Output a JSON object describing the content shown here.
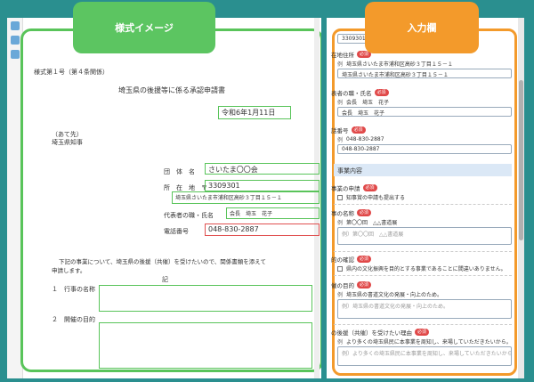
{
  "headers": {
    "left": "様式イメージ",
    "right": "入力欄"
  },
  "colors": {
    "background": "#2a8f8f",
    "green": "#5cc561",
    "orange": "#f39a2b",
    "required": "#e04848"
  },
  "document": {
    "form_no": "様式第１号（第４条関係）",
    "title": "埼玉県の後援等に係る承認申請書",
    "date": "令和6年1月11日",
    "addressee": "（あて先）",
    "governor": "埼玉県知事",
    "org_label": "団　体　名",
    "org_value": "さいたま〇〇会",
    "address_label": "所　在　地　〒",
    "postal": "3309301",
    "address": "埼玉県さいたま市浦和区高砂３丁目１５－１",
    "rep_label": "代表者の職・氏名",
    "rep_value": "会長　埼玉　花子",
    "phone_label": "電話番号",
    "phone": "048-830-2887",
    "body1": "下記の事業について、埼玉県の後援（共催）を受けたいので、関係書類を添えて",
    "body2": "申請します。",
    "ki": "記",
    "item1": "１　行事の名称",
    "item2": "２　開催の目的"
  },
  "form": {
    "postal_value": "3309301",
    "address_label": "在地住所",
    "address_row": "埼玉県さいたま市浦和区高砂３丁目１５－１",
    "address_input": "埼玉県さいたま市浦和区高砂３丁目１５－１",
    "rep_label": "表者の職・氏名",
    "rep_row": "会長　埼玉　花子",
    "rep_input": "会長　埼玉　花子",
    "phone_label": "話番号",
    "phone_row": "048-830-2887",
    "phone_input": "048-830-2887",
    "section_title": "事業内容",
    "q1_label": "事業の申請",
    "q1_option": "知事賞の申請も提出する",
    "q2_label": "事の名称",
    "q2_row": "第〇〇回　△△書道展",
    "q2_placeholder": "例）第〇〇回　△△書道展",
    "q3_label": "的の確認",
    "q3_option": "県内の文化振興を目的とする事業であることに間違いありません。",
    "q4_label": "催の目的",
    "q4_row": "埼玉県の書道文化の発展・向上のため。",
    "q4_placeholder": "例）埼玉県の書道文化の発展・向上のため。",
    "q5_label": "の後援（共催）を受けたい理由",
    "q5_row": "より多くの埼玉県民に本事業を周知し、来場していただきたいから。",
    "q5_placeholder": "例）より多くの埼玉県民に本事業を周知し、来場していただきたいから。",
    "required": "必須",
    "prefix": "例"
  }
}
